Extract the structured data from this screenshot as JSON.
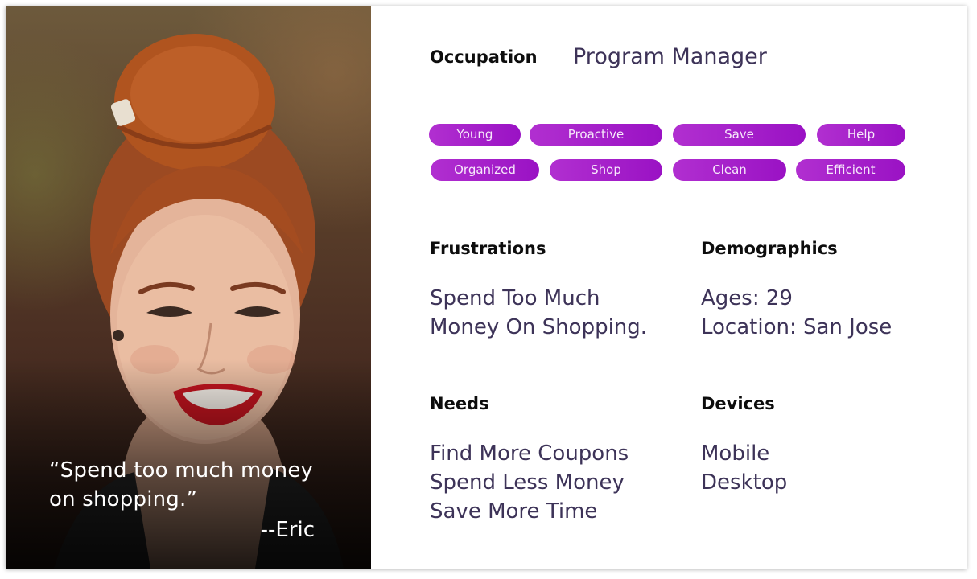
{
  "persona": {
    "photo_alt": "portrait-photo",
    "quote": "“Spend too much money on shopping.”",
    "author": "--Eric"
  },
  "occupation": {
    "label": "Occupation",
    "value": "Program Manager"
  },
  "tags": [
    "Young",
    "Proactive",
    "Save",
    "Help",
    "Organized",
    "Shop",
    "Clean",
    "Efficient"
  ],
  "frustrations": {
    "label": "Frustrations",
    "lines": [
      "Spend Too Much",
      "Money On Shopping."
    ]
  },
  "demographics": {
    "label": "Demographics",
    "lines": [
      "Ages: 29",
      "Location: San Jose"
    ]
  },
  "needs": {
    "label": "Needs",
    "lines": [
      "Find More Coupons",
      "Spend Less Money",
      "Save More Time"
    ]
  },
  "devices": {
    "label": "Devices",
    "lines": [
      "Mobile",
      "Desktop"
    ]
  },
  "colors": {
    "tag_start": "#b12fd0",
    "tag_end": "#9a12c4",
    "value_text": "#3d3358",
    "label_text": "#0d0d0d"
  }
}
